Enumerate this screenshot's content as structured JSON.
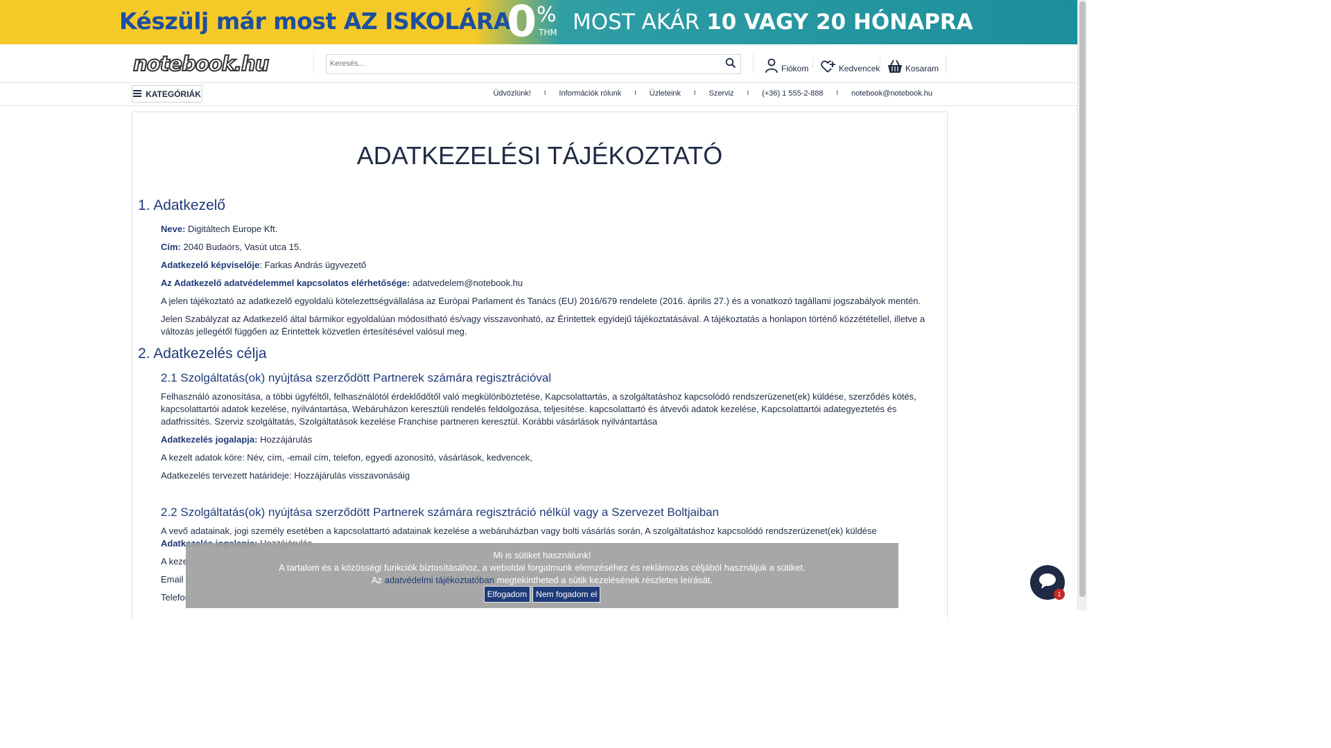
{
  "banner": {
    "left_text_a": "Készülj már most ",
    "left_text_b": "AZ ISKOLÁRA",
    "zero": "0",
    "pct": "%",
    "thm": "THM",
    "right_text_a": "MOST AKÁR ",
    "right_text_b": "10 VAGY 20 HÓNAPRA"
  },
  "header": {
    "logo": "notebook.hu",
    "search_placeholder": "Keresés...",
    "account": "Fiókom",
    "favorites": "Kedvencek",
    "cart": "Kosaram"
  },
  "nav": {
    "categories": "KATEGÓRIÁK",
    "links": [
      "Üdvözlünk!",
      "Információk rólunk",
      "Üzleteink",
      "Szerviz",
      "(+36) 1 555-2-888",
      "notebook@notebook.hu"
    ],
    "separator": "I"
  },
  "content": {
    "title": "ADATKEZELÉSI TÁJÉKOZTATÓ",
    "s1_title": "1. Adatkezelő",
    "name_label": "Neve:",
    "name_value": " Digitáltech Europe Kft.",
    "address_label": "Cím:",
    "address_value": " 2040 Budaörs, Vasút utca 15.",
    "rep_label": "Adatkezelő képviselője",
    "rep_value": ": Farkas András ügyvezető",
    "contact_label": "Az Adatkezelő adatvédelemmel kapcsolatos elérhetősége:",
    "contact_value": " adatvedelem@notebook.hu",
    "para1": "A jelen tájékoztató az adatkezelő egyoldalú kötelezettségvállalása az Európai Parlament és Tanács (EU) 2016/679 rendelete (2016. április 27.) és a vonatkozó tagállami jogszabályok mentén.",
    "para2": "Jelen Szabályzat az Adatkezelő által bármikor egyoldalúan módosítható és/vagy visszavonható, az Érintettek egyidejű tájékoztatásával. A tájékoztatás a honlapon történő közzététellel, illetve a változás jellegétől függően az Érintettek közvetlen értesítésével valósul meg.",
    "s2_title": "2. Adatkezelés célja",
    "s21_title": "2.1 Szolgáltatás(ok) nyújtása szerződött Partnerek számára regisztrációval",
    "s21_para": "Felhasználó azonosítása, a többi ügyféltől, felhasználótól érdeklődőtől való megkülönböztetése, Kapcsolattartás,  a szolgáltatáshoz kapcsolódó rendszerüzenet(ek) küldése, szerződés kötés, kapcsolattartói adatok kezelése, nyilvántartása, Webáruházon keresztüli rendelés feldolgozása, teljesítése.  kapcsolattartó és átvevői adatok kezelése, Kapcsolattartói adategyeztetés és adatfrissítés. Szerviz szolgáltatás, Szolgáltatások kezelése Franchise partneren keresztül. Korábbi vásárlások nyilvántartása",
    "legal_label": "Adatkezelés jogalapja:",
    "legal_value": " Hozzájárulás",
    "scope": "A kezelt adatok köre: Név, cím, -email cím, telefon, egyedi azonosító, vásárlások, kedvencek,",
    "duration": "Adatkezelés tervezett határideje: Hozzájárulás visszavonásáig",
    "s22_title": "2.2 Szolgáltatás(ok) nyújtása szerződött Partnerek számára regisztráció nélkül vagy a Szervezet Boltjaiban",
    "s22_para": "A vevő adatainak, jogi személy esetében a kapcsolattartó adatainak kezelése a webáruházban vagy bolti vásárlás során, A szolgáltatáshoz kapcsolódó rendszerüzenet(ek) küldése",
    "s22_legal_label": "Adatkezelés jogalapja:",
    "s22_legal_value": " Hozzájárulás",
    "s22_scope_partial": "A keze",
    "s22_email_partial": "Email c",
    "s22_phone_partial": "Telefon"
  },
  "cookie": {
    "line1": "Mi is sütiket használunk!",
    "line2": "A tartalom és a közösségi funkciók biztosításához, a weboldal forgalmunk elemzéséhez és reklámozás céljából használjuk a sütiket.",
    "line3_a": "Az ",
    "line3_link": "adatvédelmi tájékoztatóban",
    "line3_b": " megtekintheted a sütik kezelésének részletes leírását.",
    "accept": "Elfogadom",
    "decline": "Nem fogadom el"
  },
  "chat": {
    "badge": "1"
  }
}
